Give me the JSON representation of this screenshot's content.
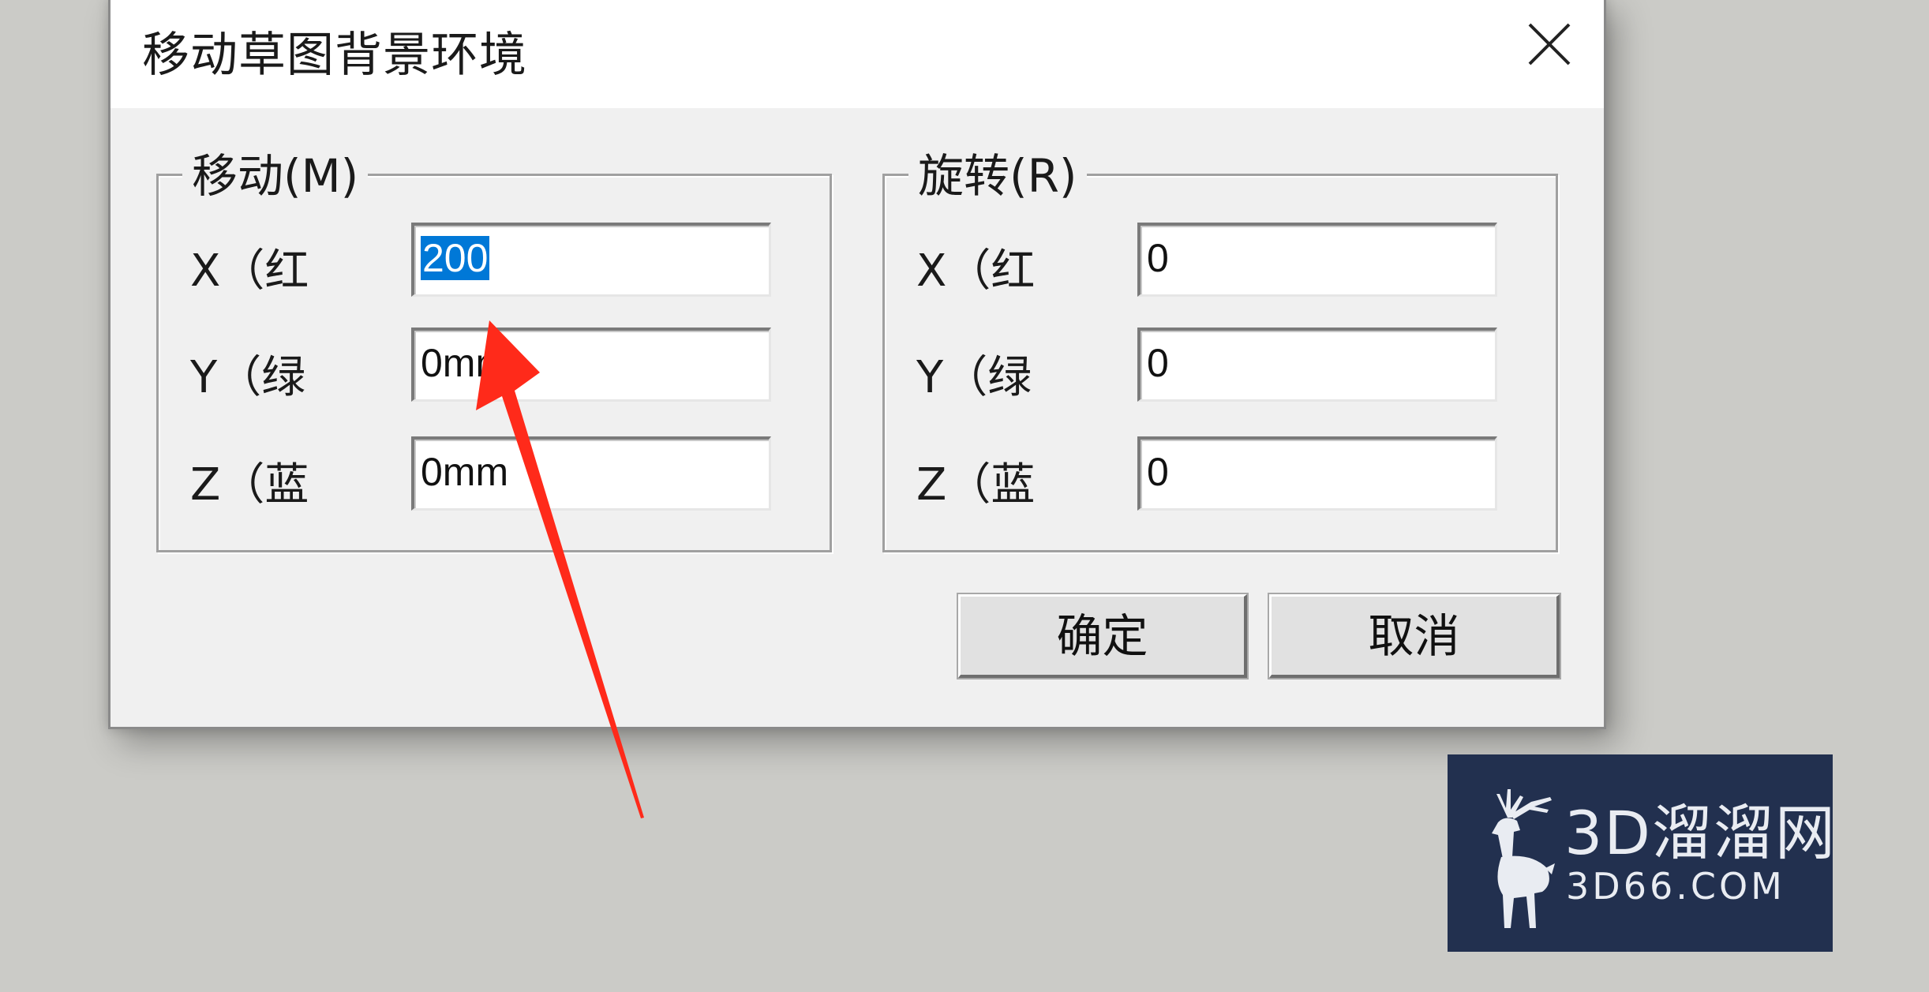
{
  "dialog": {
    "title": "移动草图背景环境",
    "close_icon": "close-icon"
  },
  "move_group": {
    "legend": "移动(M)",
    "fields": [
      {
        "label": "X（红",
        "value": "200",
        "selected": true
      },
      {
        "label": "Y（绿",
        "value": "0mm"
      },
      {
        "label": "Z（蓝",
        "value": "0mm"
      }
    ]
  },
  "rotate_group": {
    "legend": "旋转(R)",
    "fields": [
      {
        "label": "X（红",
        "value": "0"
      },
      {
        "label": "Y（绿",
        "value": "0"
      },
      {
        "label": "Z（蓝",
        "value": "0"
      }
    ]
  },
  "buttons": {
    "ok_label": "确定",
    "cancel_label": "取消"
  },
  "annotation": {
    "arrow_color": "#ff2a1a"
  },
  "watermark": {
    "brand_cn": "3D溜溜网",
    "brand_en": "3D66.COM",
    "background_color": "#22304f",
    "icon": "deer-logo-icon"
  },
  "colors": {
    "selection": "#0078d7",
    "desktop": "#cbcbc7",
    "dialog": "#f0f0f0"
  }
}
